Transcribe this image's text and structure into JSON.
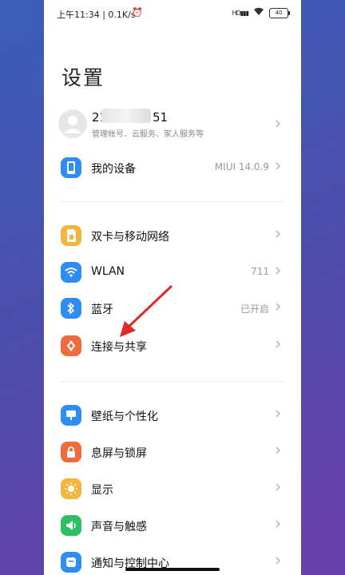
{
  "status_bar": {
    "time_speed": "上午11:34 | 0.1K/s",
    "signal": "HD",
    "battery": "40"
  },
  "page_title": "设置",
  "account": {
    "name_prefix": "21",
    "name_suffix": "51",
    "subtitle": "管理帐号、云服务、家人服务等"
  },
  "rows": {
    "my_device": {
      "label": "我的设备",
      "value": "MIUI 14.0.9"
    },
    "sim": {
      "label": "双卡与移动网络"
    },
    "wlan": {
      "label": "WLAN",
      "value": "711"
    },
    "bluetooth": {
      "label": "蓝牙",
      "value": "已开启"
    },
    "connection": {
      "label": "连接与共享"
    },
    "wallpaper": {
      "label": "壁纸与个性化"
    },
    "lockscreen": {
      "label": "息屏与锁屏"
    },
    "display": {
      "label": "显示"
    },
    "sound": {
      "label": "声音与触感"
    },
    "notification": {
      "label": "通知与控制中心"
    }
  },
  "colors": {
    "blue": "#2f8cf0",
    "yellow": "#f2b640",
    "orange": "#ef6a3c",
    "green": "#2fbf64",
    "arrow_red": "#e02a2a"
  }
}
